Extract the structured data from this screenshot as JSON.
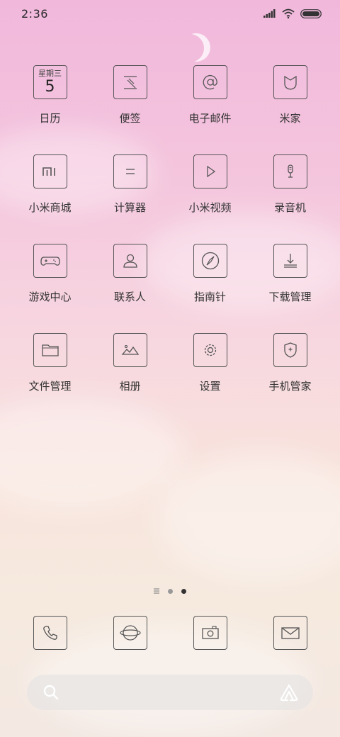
{
  "status_bar": {
    "time": "2:36"
  },
  "calendar": {
    "weekday": "星期三",
    "day": "5"
  },
  "apps": [
    {
      "label": "日历",
      "icon": "calendar-icon"
    },
    {
      "label": "便签",
      "icon": "notes-icon"
    },
    {
      "label": "电子邮件",
      "icon": "email-at-icon"
    },
    {
      "label": "米家",
      "icon": "mijia-icon"
    },
    {
      "label": "小米商城",
      "icon": "mi-store-icon"
    },
    {
      "label": "计算器",
      "icon": "calculator-icon"
    },
    {
      "label": "小米视频",
      "icon": "video-play-icon"
    },
    {
      "label": "录音机",
      "icon": "microphone-icon"
    },
    {
      "label": "游戏中心",
      "icon": "gamepad-icon"
    },
    {
      "label": "联系人",
      "icon": "person-icon"
    },
    {
      "label": "指南针",
      "icon": "compass-icon"
    },
    {
      "label": "下载管理",
      "icon": "download-icon"
    },
    {
      "label": "文件管理",
      "icon": "folder-icon"
    },
    {
      "label": "相册",
      "icon": "gallery-icon"
    },
    {
      "label": "设置",
      "icon": "gear-icon"
    },
    {
      "label": "手机管家",
      "icon": "shield-icon"
    }
  ],
  "dock": [
    {
      "name": "phone",
      "icon": "phone-icon"
    },
    {
      "name": "browser",
      "icon": "browser-icon"
    },
    {
      "name": "camera",
      "icon": "camera-icon"
    },
    {
      "name": "messages",
      "icon": "message-icon"
    }
  ],
  "page_indicator": {
    "pages": 3,
    "current": 3
  },
  "colors": {
    "icon_stroke": "#555555",
    "label": "#333333"
  }
}
